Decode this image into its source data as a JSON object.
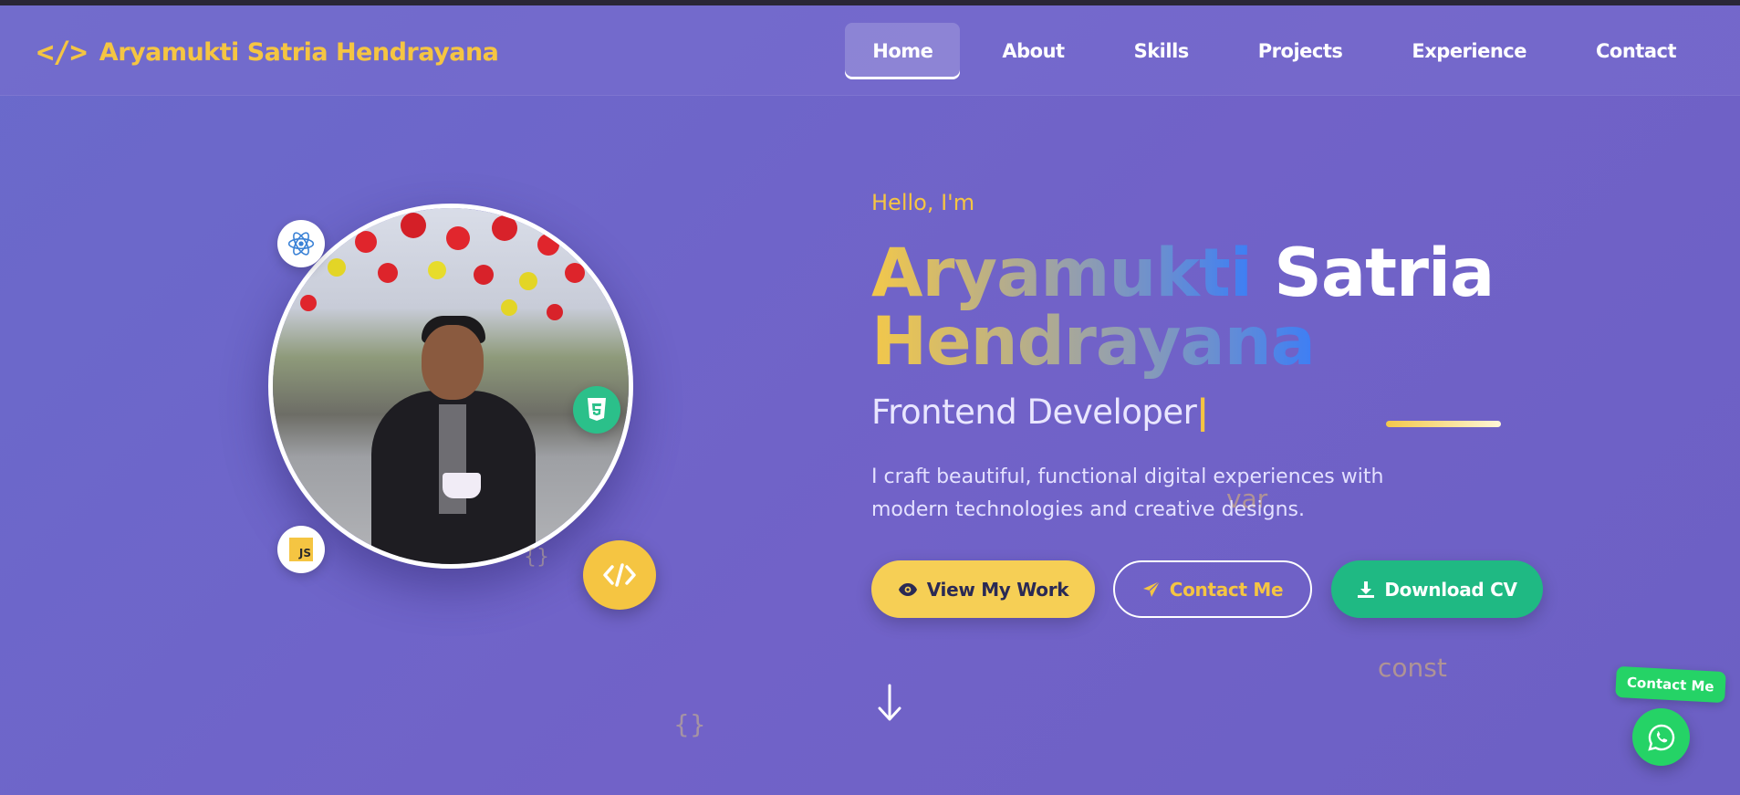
{
  "brand": {
    "icon_text": "</>",
    "name": "Aryamukti Satria Hendrayana"
  },
  "nav": {
    "items": [
      {
        "label": "Home",
        "active": true
      },
      {
        "label": "About"
      },
      {
        "label": "Skills"
      },
      {
        "label": "Projects"
      },
      {
        "label": "Experience"
      },
      {
        "label": "Contact"
      }
    ]
  },
  "hero": {
    "greeting": "Hello, I'm",
    "name_first": "Aryamukti",
    "name_middle": "Satria",
    "name_last": "Hendrayana",
    "role": "Frontend Developer",
    "cursor": "|",
    "description": "I craft beautiful, functional digital experiences with modern technologies and creative designs.",
    "buttons": {
      "view_work": "View My Work",
      "contact": "Contact Me",
      "download_cv": "Download CV"
    }
  },
  "floating_code": {
    "var": "var",
    "const": "const",
    "brace1": "{}",
    "brace2": "{}"
  },
  "badges": {
    "js": "JS"
  },
  "whatsapp": {
    "label": "Contact Me"
  },
  "icons": {
    "brand": "code-brackets-icon",
    "react": "react-icon",
    "html": "html5-icon",
    "js": "javascript-icon",
    "code": "code-icon",
    "eye": "eye-icon",
    "send": "paper-plane-icon",
    "download": "download-icon",
    "arrow": "arrow-down-icon",
    "whatsapp": "whatsapp-icon"
  },
  "colors": {
    "accent_yellow": "#f5c542",
    "accent_green": "#1fb983",
    "whatsapp_green": "#25d366",
    "background": "#6e64c8"
  }
}
